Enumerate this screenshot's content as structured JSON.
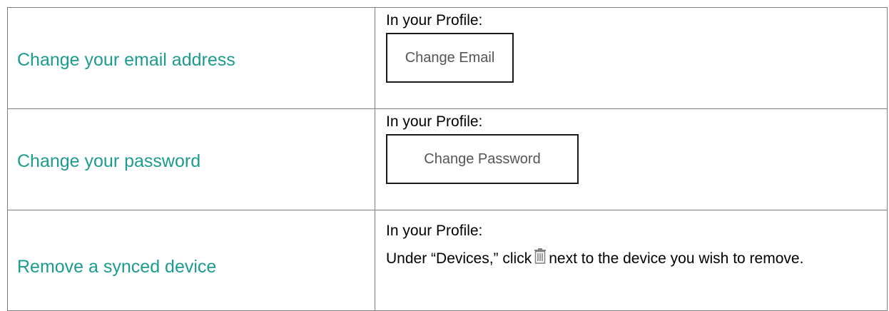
{
  "rows": [
    {
      "task": "Change your email address",
      "intro": "In your Profile:",
      "button_label": "Change Email"
    },
    {
      "task": "Change your password",
      "intro": "In your Profile:",
      "button_label": "Change Password"
    },
    {
      "task": "Remove a synced device",
      "intro": "In your Profile:",
      "instruction_before_icon": "Under “Devices,” click",
      "icon": "trash-icon",
      "instruction_after_icon": "next to the device you wish to remove."
    }
  ],
  "colors": {
    "task_text": "#1b9c8f",
    "border": "#7f7f7f",
    "button_text": "#555555"
  }
}
